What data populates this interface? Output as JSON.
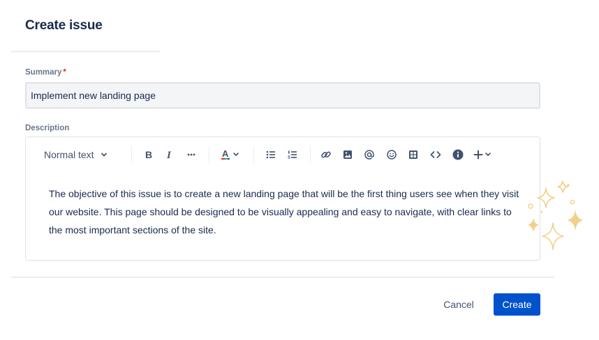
{
  "dialog": {
    "title": "Create issue"
  },
  "summary": {
    "label": "Summary",
    "required_marker": "*",
    "value": "Implement new landing page"
  },
  "description": {
    "label": "Description",
    "text": "The objective of this issue is to create a new landing page that will be the first thing users see when they visit our website. This page should be designed to be visually appealing and easy to navigate, with clear links to the most important sections of the site."
  },
  "toolbar": {
    "text_style": "Normal text",
    "items": [
      "chevron-down-icon",
      "bold-icon",
      "italic-icon",
      "more-formatting-icon",
      "text-color-icon",
      "bullet-list-icon",
      "numbered-list-icon",
      "link-icon",
      "image-icon",
      "mention-icon",
      "emoji-icon",
      "table-icon",
      "code-icon",
      "info-icon",
      "insert-plus-icon"
    ]
  },
  "actions": {
    "cancel": "Cancel",
    "create": "Create"
  },
  "colors": {
    "primary": "#0052CC",
    "text": "#172B4D",
    "subtle": "#6B778C",
    "required": "#DE350B",
    "sparkle": "#F2D08A"
  }
}
